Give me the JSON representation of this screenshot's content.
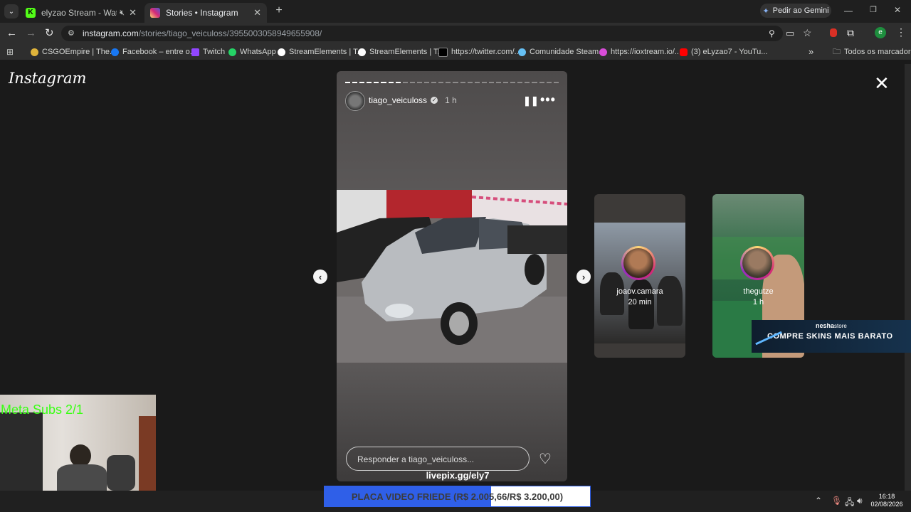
{
  "browser": {
    "tabs": [
      {
        "title": "elyzao Stream - Watch Live"
      },
      {
        "title": "Stories • Instagram"
      }
    ],
    "new_tab": "+",
    "gemini_button": "Pedir ao Gemini",
    "url_host": "instagram.com",
    "url_path": "/stories/tiago_veiculoss/3955003058949655908/",
    "profile_initial": "e",
    "bookmarks": [
      {
        "label": "CSGOEmpire | The..."
      },
      {
        "label": "Facebook – entre o..."
      },
      {
        "label": "Twitch"
      },
      {
        "label": "WhatsApp"
      },
      {
        "label": "StreamElements | T..."
      },
      {
        "label": "StreamElements | T..."
      },
      {
        "label": "https://twitter.com/..."
      },
      {
        "label": "Comunidade Steam..."
      },
      {
        "label": "https://ioxtream.io/..."
      },
      {
        "label": "(3) eLyzao7 - YouTu..."
      }
    ],
    "more_bookmarks": "»",
    "all_bookmarks": "Todos os marcadores"
  },
  "instagram": {
    "logo": "Instagram",
    "story": {
      "username": "tiago_veiculoss",
      "time": "1 h",
      "reply_placeholder": "Responder a tiago_veiculoss...",
      "progress_segments": 30,
      "progress_done": 8
    },
    "next_stories": [
      {
        "username": "joaov.camara",
        "time": "20 min"
      },
      {
        "username": "thegutze",
        "time": "1 h"
      }
    ]
  },
  "overlay": {
    "meta_subs": "Meta Subs 2/1",
    "sponsor_brand": "nesha",
    "sponsor_brand_suffix": "store",
    "sponsor_text": "COMPRE SKINS MAIS BARATO",
    "livepix": "livepix.gg/ely7",
    "goal_text": "PLACA VIDEO FRIEDE (R$ 2.005,66/R$ 3.200,00)",
    "goal_progress": 0.6268
  },
  "taskbar": {
    "time": "16:18",
    "date": "02/08/2026"
  }
}
